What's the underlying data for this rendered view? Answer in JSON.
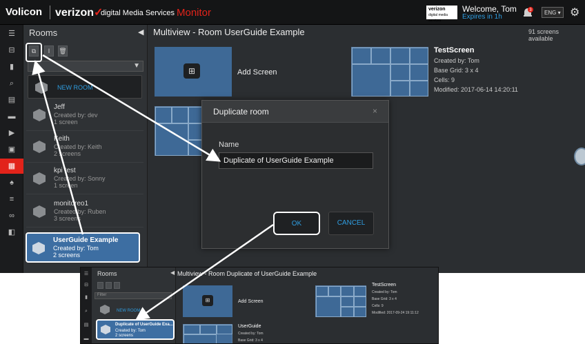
{
  "header": {
    "logo": "Volicon",
    "brand": "verizon",
    "subbrand": "digital Media Services",
    "product": "Monitor",
    "badge_line1": "verizon",
    "badge_line2": "digital media services",
    "welcome": "Welcome, Tom",
    "expires": "Expires in 1h",
    "notification_count": "3",
    "language": "ENG"
  },
  "rooms_panel": {
    "title": "Rooms",
    "new_room": "NEW ROOM",
    "rooms": [
      {
        "name": "Jeff",
        "created": "Created by: dev",
        "screens": "1 screen"
      },
      {
        "name": "Keith",
        "created": "Created by: Keith",
        "screens": "2 screens"
      },
      {
        "name": "kpi test",
        "created": "Created by: Sonny",
        "screens": "1 screen"
      },
      {
        "name": "monitoreo1",
        "created": "Created by: Ruben",
        "screens": "3 screens"
      },
      {
        "name": "UserGuide Example",
        "created": "Created by: Tom",
        "screens": "2 screens"
      }
    ]
  },
  "main": {
    "title": "Multiview - Room UserGuide Example",
    "available": "91 screens available",
    "add_screen": "Add Screen",
    "test_screen": {
      "name": "TestScreen",
      "created": "Created by: Tom",
      "grid": "Base Grid: 3 x 4",
      "cells": "Cells: 9",
      "modified": "Modified: 2017-06-14 14:20:11"
    }
  },
  "dialog": {
    "title": "Duplicate room",
    "close": "×",
    "name_label": "Name",
    "name_value": "Duplicate of UserGuide Example",
    "ok": "OK",
    "cancel": "CANCEL"
  },
  "inset": {
    "rooms_title": "Rooms",
    "filter_placeholder": "Filter",
    "new_room": "NEW ROOM",
    "title": "Multiview - Room Duplicate of UserGuide Example",
    "add_screen": "Add Screen",
    "selected_room": {
      "name": "Duplicate of UserGuide Exa...",
      "created": "Created by: Tom",
      "screens": "2 screens"
    },
    "test_screen": {
      "name": "TestScreen",
      "created": "Created by: Tom",
      "grid": "Base Grid: 3 x 4",
      "cells": "Cells: 9",
      "modified": "Modified: 2017-09-24 19:11:12"
    },
    "userguide": {
      "name": "UserGuide",
      "created": "Created by: Tom",
      "grid": "Base Grid: 3 x 4"
    }
  }
}
